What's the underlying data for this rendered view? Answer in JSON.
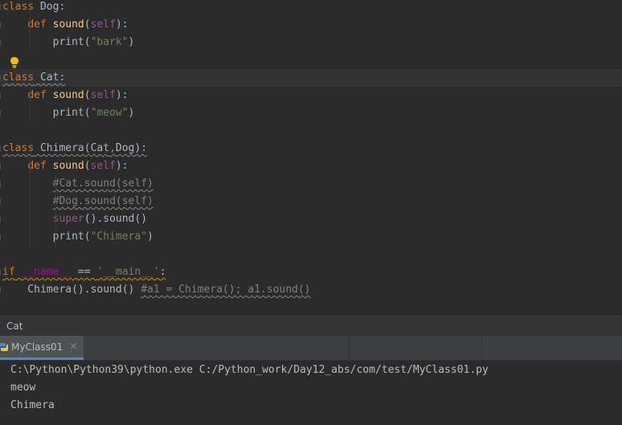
{
  "editor": {
    "lines": [
      {
        "tokens": [
          [
            "kw",
            "class"
          ],
          [
            "plain",
            " Dog:"
          ]
        ]
      },
      {
        "tokens": [
          [
            "plain",
            "    "
          ],
          [
            "kw",
            "def"
          ],
          [
            "plain",
            " "
          ],
          [
            "fn",
            "sound"
          ],
          [
            "plain",
            "("
          ],
          [
            "self",
            "self"
          ],
          [
            "plain",
            "):"
          ]
        ]
      },
      {
        "tokens": [
          [
            "plain",
            "        print("
          ],
          [
            "str",
            "\"bark\""
          ],
          [
            "plain",
            ")"
          ]
        ]
      },
      {
        "tokens": []
      },
      {
        "tokens": [
          [
            "kw wavy",
            "class"
          ],
          [
            "plain wavy",
            " Cat:"
          ]
        ],
        "current": true
      },
      {
        "tokens": [
          [
            "plain",
            "    "
          ],
          [
            "kw",
            "def"
          ],
          [
            "plain",
            " "
          ],
          [
            "fn",
            "sound"
          ],
          [
            "plain",
            "("
          ],
          [
            "self",
            "self"
          ],
          [
            "plain",
            "):"
          ]
        ]
      },
      {
        "tokens": [
          [
            "plain",
            "        print("
          ],
          [
            "str",
            "\"meow\""
          ],
          [
            "plain",
            ")"
          ]
        ]
      },
      {
        "tokens": []
      },
      {
        "tokens": [
          [
            "kw wavy",
            "class"
          ],
          [
            "plain wavy",
            " Chimera(Cat"
          ],
          [
            "kw wavy",
            ","
          ],
          [
            "plain wavy",
            "Dog):"
          ]
        ]
      },
      {
        "tokens": [
          [
            "plain",
            "    "
          ],
          [
            "kw",
            "def"
          ],
          [
            "plain",
            " "
          ],
          [
            "fn",
            "sound"
          ],
          [
            "plain",
            "("
          ],
          [
            "self",
            "self"
          ],
          [
            "plain",
            "):"
          ]
        ]
      },
      {
        "tokens": [
          [
            "plain",
            "        "
          ],
          [
            "cmt wavy",
            "#Cat.sound(self)"
          ]
        ]
      },
      {
        "tokens": [
          [
            "plain",
            "        "
          ],
          [
            "cmt wavy",
            "#Dog.sound(self)"
          ]
        ]
      },
      {
        "tokens": [
          [
            "plain",
            "        "
          ],
          [
            "self",
            "super"
          ],
          [
            "plain",
            "().sound()"
          ]
        ]
      },
      {
        "tokens": [
          [
            "plain",
            "        print("
          ],
          [
            "str",
            "\"Chimera\""
          ],
          [
            "plain",
            ")"
          ]
        ]
      },
      {
        "tokens": []
      },
      {
        "tokens": [
          [
            "kw wavy-warn",
            "if"
          ],
          [
            "plain wavy-warn",
            " "
          ],
          [
            "dunder wavy-warn",
            "__name__"
          ],
          [
            "plain wavy-warn",
            " == "
          ],
          [
            "str wavy-warn",
            "'__main__'"
          ],
          [
            "plain wavy-warn",
            ":"
          ]
        ]
      },
      {
        "tokens": [
          [
            "plain",
            "    Chimera().sound() "
          ],
          [
            "cmt wavy",
            "#a1 = Chimera(); a1.sound()"
          ]
        ]
      }
    ]
  },
  "breadcrumb": {
    "text": "Cat"
  },
  "run_panel": {
    "tab_label": "MyClass01",
    "close_glyph": "×",
    "output": [
      "C:\\Python\\Python39\\python.exe C:/Python_work/Day12_abs/com/test/MyClass01.py",
      "meow",
      "Chimera"
    ]
  },
  "icons": {
    "bulb": "lightbulb-icon",
    "python": "python-icon",
    "close": "close-icon"
  },
  "colors": {
    "keyword": "#cc7832",
    "function": "#ffc66d",
    "self": "#94558d",
    "string": "#6a8759",
    "comment": "#808080",
    "dunder": "#b200b2",
    "accent_tab": "#4a88c7",
    "bulb": "#f0c000"
  }
}
